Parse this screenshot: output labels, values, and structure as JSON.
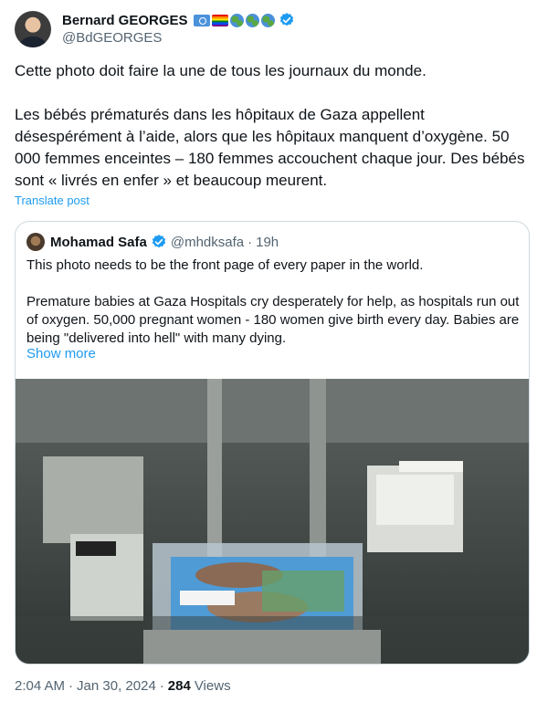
{
  "author": {
    "display_name": "Bernard GEORGES",
    "handle": "@BdGEORGES",
    "badges": [
      "un-flag",
      "rainbow-flag",
      "globe",
      "globe",
      "globe",
      "verified"
    ]
  },
  "tweet": {
    "paragraph_1": "Cette photo doit faire la une de tous les journaux du monde.",
    "paragraph_2": "Les bébés prématurés dans les hôpitaux de Gaza appellent désespérément à l’aide, alors que les hôpitaux manquent d’oxygène.  50 000 femmes enceintes – 180 femmes accouchent chaque jour.  Des bébés sont « livrés en enfer » et beaucoup meurent.",
    "translate_label": "Translate post"
  },
  "quoted": {
    "display_name": "Mohamad Safa",
    "handle": "@mhdksafa",
    "separator": "·",
    "time": "19h",
    "paragraph_1": "This photo needs to be the front page of every paper in the world.",
    "paragraph_2": "Premature babies at Gaza Hospitals cry desperately for help, as hospitals run out of oxygen. 50,000 pregnant women - 180 women give birth every day. Babies are being \"delivered into hell\" with many dying.",
    "show_more": "Show more"
  },
  "meta": {
    "time": "2:04 AM",
    "sep1": "·",
    "date": "Jan 30, 2024",
    "sep2": "·",
    "views_count": "284",
    "views_label": "Views"
  },
  "colors": {
    "link": "#1d9bf0",
    "secondary_text": "#536471",
    "border": "#cfd9de",
    "verified": "#1d9bf0"
  }
}
